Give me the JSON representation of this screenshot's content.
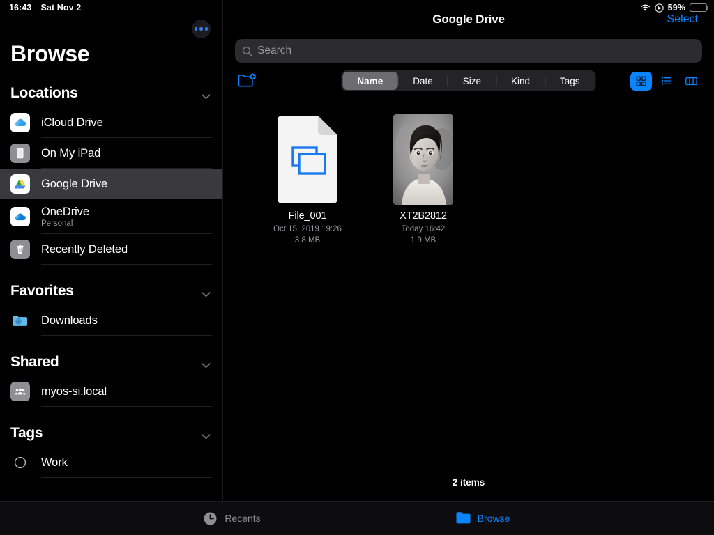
{
  "statusbar": {
    "time": "16:43",
    "date": "Sat Nov 2",
    "battery_percent": "59%",
    "wifi_icon": "wifi-icon",
    "orientation_lock_icon": "rotation-lock-icon",
    "battery_icon": "battery-icon"
  },
  "sidebar": {
    "title": "Browse",
    "more_icon": "ellipsis-circle-icon",
    "sections": [
      {
        "title": "Locations",
        "collapse_icon": "chevron-down-icon",
        "items": [
          {
            "label": "iCloud Drive",
            "sub": "",
            "icon": "icloud-drive-icon",
            "selected": false
          },
          {
            "label": "On My iPad",
            "sub": "",
            "icon": "ipad-icon",
            "selected": false
          },
          {
            "label": "Google Drive",
            "sub": "",
            "icon": "google-drive-icon",
            "selected": true
          },
          {
            "label": "OneDrive",
            "sub": "Personal",
            "icon": "onedrive-icon",
            "selected": false
          },
          {
            "label": "Recently Deleted",
            "sub": "",
            "icon": "trash-icon",
            "selected": false
          }
        ]
      },
      {
        "title": "Favorites",
        "collapse_icon": "chevron-down-icon",
        "items": [
          {
            "label": "Downloads",
            "sub": "",
            "icon": "downloads-folder-icon",
            "selected": false
          }
        ]
      },
      {
        "title": "Shared",
        "collapse_icon": "chevron-down-icon",
        "items": [
          {
            "label": "myos-si.local",
            "sub": "",
            "icon": "shared-users-icon",
            "selected": false
          }
        ]
      },
      {
        "title": "Tags",
        "collapse_icon": "chevron-down-icon",
        "items": [
          {
            "label": "Work",
            "sub": "",
            "icon": "tag-circle-icon",
            "selected": false
          }
        ]
      }
    ]
  },
  "content": {
    "title": "Google Drive",
    "select_label": "Select",
    "search": {
      "placeholder": "Search",
      "value": "",
      "icon": "search-icon"
    },
    "new_folder_icon": "new-folder-icon",
    "sort_options": [
      "Name",
      "Date",
      "Size",
      "Kind",
      "Tags"
    ],
    "sort_selected": "Name",
    "view_modes": [
      {
        "name": "grid-view-icon",
        "active": true
      },
      {
        "name": "list-view-icon",
        "active": false
      },
      {
        "name": "column-view-icon",
        "active": false
      }
    ],
    "files": [
      {
        "name": "File_001",
        "date": "Oct 15, 2019 19:26",
        "size": "3.8 MB",
        "kind": "document"
      },
      {
        "name": "XT2B2812",
        "date": "Today 16:42",
        "size": "1.9 MB",
        "kind": "photo"
      }
    ],
    "item_count": "2 items"
  },
  "tabbar": {
    "tabs": [
      {
        "label": "Recents",
        "icon": "clock-icon",
        "active": false
      },
      {
        "label": "Browse",
        "icon": "folder-icon",
        "active": true
      }
    ]
  },
  "colors": {
    "accent": "#0a84ff",
    "background": "#000000",
    "selected_row": "#3a3a3c",
    "field": "#2c2c2e",
    "secondary_text": "#9a9a9e"
  }
}
